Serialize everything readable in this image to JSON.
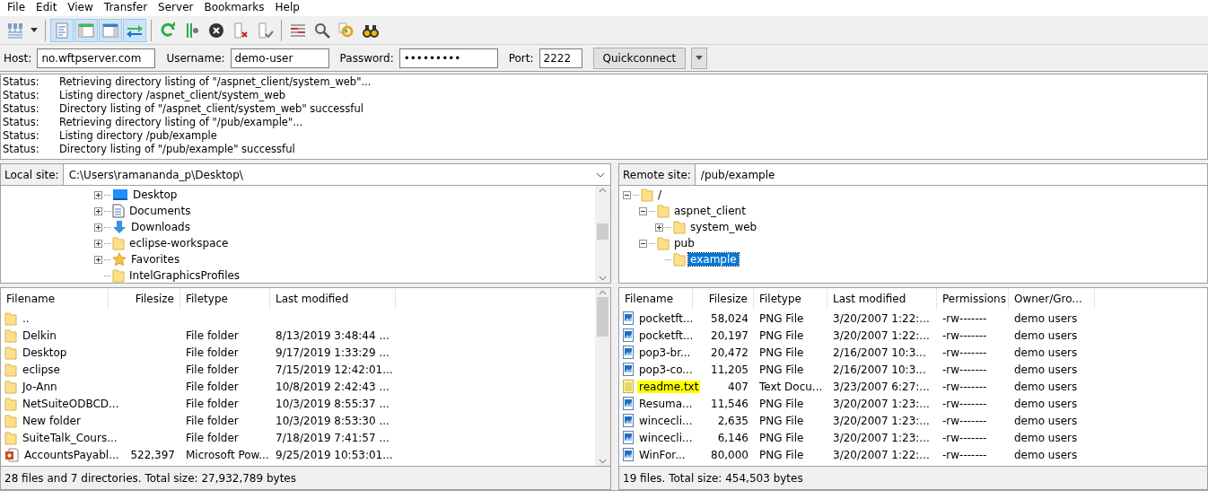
{
  "menu": [
    "File",
    "Edit",
    "View",
    "Transfer",
    "Server",
    "Bookmarks",
    "Help"
  ],
  "toolbar": [
    [
      {
        "kind": "site-manager",
        "selected": false
      },
      {
        "kind": "dropdown",
        "selected": false
      }
    ],
    [
      {
        "kind": "log",
        "selected": true
      },
      {
        "kind": "local-tree",
        "selected": true
      },
      {
        "kind": "remote-tree",
        "selected": true
      },
      {
        "kind": "queue",
        "selected": true
      }
    ],
    [
      {
        "kind": "refresh",
        "selected": false
      },
      {
        "kind": "filter-settings",
        "selected": false
      },
      {
        "kind": "cancel",
        "selected": false
      },
      {
        "kind": "disconnect",
        "selected": false
      },
      {
        "kind": "reconnect",
        "selected": false
      }
    ],
    [
      {
        "kind": "compare",
        "selected": false
      },
      {
        "kind": "search",
        "selected": false
      },
      {
        "kind": "sync",
        "selected": false
      },
      {
        "kind": "find",
        "selected": false
      }
    ]
  ],
  "quickconnect": {
    "host_label": "Host:",
    "host": "no.wftpserver.com",
    "user_label": "Username:",
    "user": "demo-user",
    "password_label": "Password:",
    "password": "•••••••••",
    "port_label": "Port:",
    "port": "2222",
    "button": "Quickconnect"
  },
  "log": [
    {
      "label": "Status:",
      "message": "Retrieving directory listing of \"/aspnet_client/system_web\"..."
    },
    {
      "label": "Status:",
      "message": "Listing directory /aspnet_client/system_web"
    },
    {
      "label": "Status:",
      "message": "Directory listing of \"/aspnet_client/system_web\" successful"
    },
    {
      "label": "Status:",
      "message": "Retrieving directory listing of \"/pub/example\"..."
    },
    {
      "label": "Status:",
      "message": "Listing directory /pub/example"
    },
    {
      "label": "Status:",
      "message": "Directory listing of \"/pub/example\" successful"
    }
  ],
  "local_site": {
    "label": "Local site:",
    "path": "C:\\Users\\ramananda_p\\Desktop\\",
    "tree": [
      {
        "name": "Desktop",
        "kind": "desktop",
        "expandable": true,
        "selected": false
      },
      {
        "name": "Documents",
        "kind": "document",
        "expandable": true,
        "selected": false
      },
      {
        "name": "Downloads",
        "kind": "download",
        "expandable": true,
        "selected": false
      },
      {
        "name": "eclipse-workspace",
        "kind": "folder",
        "expandable": true,
        "selected": false
      },
      {
        "name": "Favorites",
        "kind": "star",
        "expandable": true,
        "selected": false
      },
      {
        "name": "IntelGraphicsProfiles",
        "kind": "folder",
        "expandable": false,
        "selected": false
      }
    ]
  },
  "remote_site": {
    "label": "Remote site:",
    "path": "/pub/example",
    "tree": [
      {
        "name": "/",
        "expanded": true,
        "selected": false,
        "children": [
          {
            "name": "aspnet_client",
            "expanded": true,
            "selected": false,
            "children": [
              {
                "name": "system_web",
                "expanded": false,
                "selected": false
              }
            ]
          },
          {
            "name": "pub",
            "expanded": true,
            "selected": false,
            "children": [
              {
                "name": "example",
                "selected": true
              }
            ]
          }
        ]
      }
    ]
  },
  "local_files": {
    "columns": [
      "Filename",
      "Filesize",
      "Filetype",
      "Last modified"
    ],
    "rows": [
      {
        "kind": "folder",
        "name": "..",
        "size": "",
        "type": "",
        "modified": ""
      },
      {
        "kind": "folder",
        "name": "Delkin",
        "size": "",
        "type": "File folder",
        "modified": "8/13/2019 3:48:44 ..."
      },
      {
        "kind": "folder",
        "name": "Desktop",
        "size": "",
        "type": "File folder",
        "modified": "9/17/2019 1:33:29 ..."
      },
      {
        "kind": "folder",
        "name": "eclipse",
        "size": "",
        "type": "File folder",
        "modified": "7/15/2019 12:42:01..."
      },
      {
        "kind": "folder",
        "name": "Jo-Ann",
        "size": "",
        "type": "File folder",
        "modified": "10/8/2019 2:42:43 ..."
      },
      {
        "kind": "folder",
        "name": "NetSuiteODBCD...",
        "size": "",
        "type": "File folder",
        "modified": "10/3/2019 8:55:37 ..."
      },
      {
        "kind": "folder",
        "name": "New folder",
        "size": "",
        "type": "File folder",
        "modified": "10/3/2019 8:53:30 ..."
      },
      {
        "kind": "folder",
        "name": "SuiteTalk_Cours...",
        "size": "",
        "type": "File folder",
        "modified": "7/18/2019 7:41:57 ..."
      },
      {
        "kind": "presentation",
        "name": "AccountsPayabl...",
        "size": "522,397",
        "type": "Microsoft Pow...",
        "modified": "9/25/2019 10:53:01..."
      }
    ],
    "status": "28 files and 7 directories. Total size: 27,932,789 bytes"
  },
  "remote_files": {
    "columns": [
      "Filename",
      "Filesize",
      "Filetype",
      "Last modified",
      "Permissions",
      "Owner/Gro..."
    ],
    "rows": [
      {
        "kind": "image",
        "name": "pocketft...",
        "size": "58,024",
        "type": "PNG File",
        "modified": "3/20/2007 1:22:...",
        "permissions": "-rw-------",
        "owner": "demo users",
        "highlighted": false
      },
      {
        "kind": "image",
        "name": "pocketft...",
        "size": "20,197",
        "type": "PNG File",
        "modified": "3/20/2007 1:22:...",
        "permissions": "-rw-------",
        "owner": "demo users",
        "highlighted": false
      },
      {
        "kind": "image",
        "name": "pop3-br...",
        "size": "20,472",
        "type": "PNG File",
        "modified": "2/16/2007 10:3...",
        "permissions": "-rw-------",
        "owner": "demo users",
        "highlighted": false
      },
      {
        "kind": "image",
        "name": "pop3-co...",
        "size": "11,205",
        "type": "PNG File",
        "modified": "2/16/2007 10:3...",
        "permissions": "-rw-------",
        "owner": "demo users",
        "highlighted": false
      },
      {
        "kind": "text",
        "name": "readme.txt",
        "size": "407",
        "type": "Text Docu...",
        "modified": "3/23/2007 6:27:...",
        "permissions": "-rw-------",
        "owner": "demo users",
        "highlighted": true
      },
      {
        "kind": "image",
        "name": "Resuma...",
        "size": "11,546",
        "type": "PNG File",
        "modified": "3/20/2007 1:23:...",
        "permissions": "-rw-------",
        "owner": "demo users",
        "highlighted": false
      },
      {
        "kind": "image",
        "name": "wincecli...",
        "size": "2,635",
        "type": "PNG File",
        "modified": "3/20/2007 1:23:...",
        "permissions": "-rw-------",
        "owner": "demo users",
        "highlighted": false
      },
      {
        "kind": "image",
        "name": "wincecli...",
        "size": "6,146",
        "type": "PNG File",
        "modified": "3/20/2007 1:23:...",
        "permissions": "-rw-------",
        "owner": "demo users",
        "highlighted": false
      },
      {
        "kind": "image",
        "name": "WinFor...",
        "size": "80,000",
        "type": "PNG File",
        "modified": "3/20/2007 1:22:...",
        "permissions": "-rw-------",
        "owner": "demo users",
        "highlighted": false
      }
    ],
    "status": "19 files. Total size: 454,503 bytes"
  }
}
